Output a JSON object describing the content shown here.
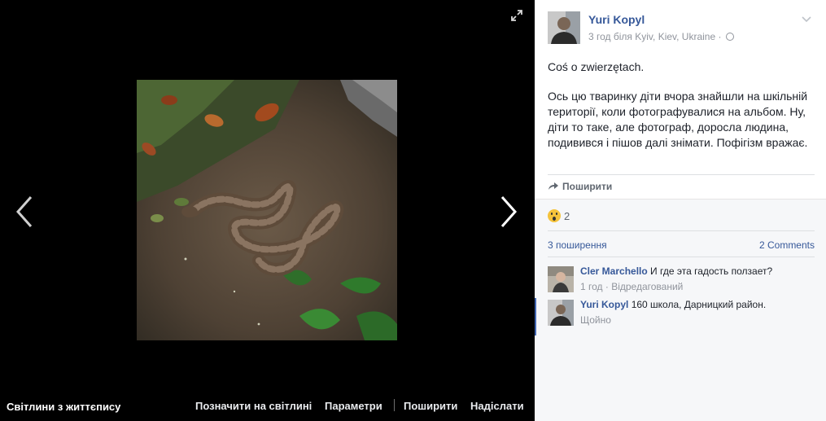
{
  "viewer": {
    "album_link": "Світлини з життєпису",
    "actions": {
      "tag": "Позначити на світлині",
      "options": "Параметри",
      "share": "Поширити",
      "send": "Надіслати"
    },
    "icons": {
      "prev": "chevron-left-icon",
      "next": "chevron-right-icon",
      "fullscreen": "expand-icon"
    }
  },
  "post": {
    "author": "Yuri Kopyl",
    "time_location": "3 год біля Kyiv, Kiev, Ukraine ·",
    "text_line1": "Coś o zwierzętach.",
    "text_line2": "Ось цю тваринку діти вчора знайшли на шкільній території, коли фотографувалися на альбом. Ну, діти то таке, але фотограф, доросла людина, подивився і пішов далі знімати. Пофігізм вражає.",
    "share_label": "Поширити"
  },
  "feedback": {
    "reaction_count": "2",
    "shares": "3 поширення",
    "comments": "2 Comments"
  },
  "comments": [
    {
      "author": "Cler Marchello",
      "text": "И где эта гадость ползает?",
      "meta": "1 год · Відредагований"
    },
    {
      "author": "Yuri Kopyl",
      "text": "160 школа, Дарницкий район.",
      "meta": "Щойно"
    }
  ],
  "colors": {
    "link": "#365899",
    "viewer_bg": "#000000",
    "feedback_bg": "#f6f7f9"
  }
}
